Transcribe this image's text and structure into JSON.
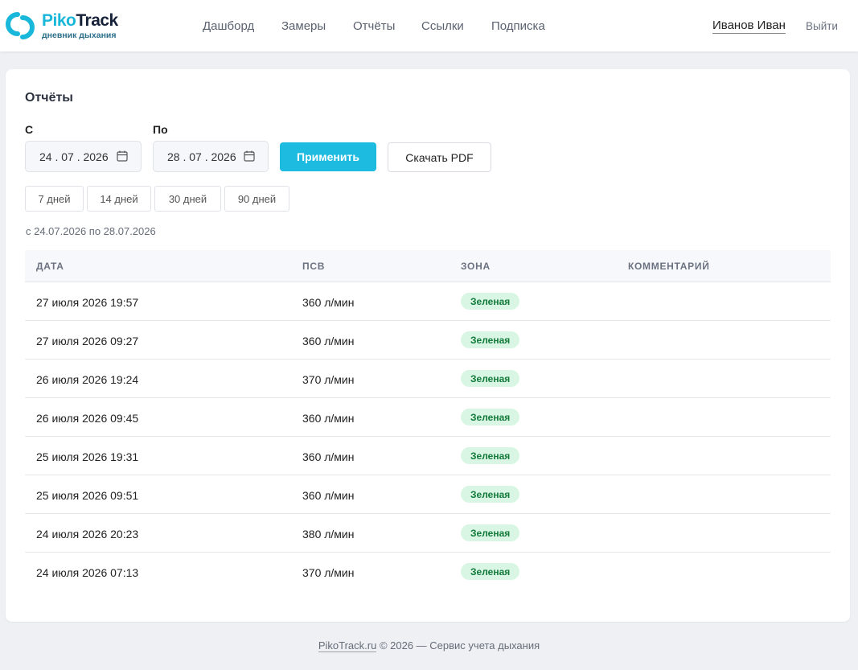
{
  "brand": {
    "name_part1": "Piko",
    "name_part2": "Track",
    "tagline": "дневник дыхания",
    "accent_color": "#1dbbe0"
  },
  "nav": {
    "items": [
      "Дашборд",
      "Замеры",
      "Отчёты",
      "Ссылки",
      "Подписка"
    ]
  },
  "user": {
    "name": "Иванов Иван",
    "logout": "Выйти"
  },
  "page": {
    "title": "Отчёты"
  },
  "filters": {
    "from_label": "С",
    "to_label": "По",
    "from_value": "24 . 07 . 2026",
    "to_value": "28 . 07 . 2026",
    "apply": "Применить",
    "download": "Скачать PDF",
    "ranges": [
      "7 дней",
      "14 дней",
      "30 дней",
      "90 дней"
    ],
    "range_text": "с 24.07.2026 по 28.07.2026"
  },
  "table": {
    "headers": [
      "ДАТА",
      "ПСВ",
      "ЗОНА",
      "КОММЕНТАРИЙ"
    ],
    "rows": [
      {
        "date": "27 июля 2026 19:57",
        "psv": "360 л/мин",
        "zone": "Зеленая",
        "comment": ""
      },
      {
        "date": "27 июля 2026 09:27",
        "psv": "360 л/мин",
        "zone": "Зеленая",
        "comment": ""
      },
      {
        "date": "26 июля 2026 19:24",
        "psv": "370 л/мин",
        "zone": "Зеленая",
        "comment": ""
      },
      {
        "date": "26 июля 2026 09:45",
        "psv": "360 л/мин",
        "zone": "Зеленая",
        "comment": ""
      },
      {
        "date": "25 июля 2026 19:31",
        "psv": "360 л/мин",
        "zone": "Зеленая",
        "comment": ""
      },
      {
        "date": "25 июля 2026 09:51",
        "psv": "360 л/мин",
        "zone": "Зеленая",
        "comment": ""
      },
      {
        "date": "24 июля 2026 20:23",
        "psv": "380 л/мин",
        "zone": "Зеленая",
        "comment": ""
      },
      {
        "date": "24 июля 2026 07:13",
        "psv": "370 л/мин",
        "zone": "Зеленая",
        "comment": ""
      }
    ]
  },
  "footer": {
    "link": "PikoTrack.ru",
    "text": " © 2026 — Сервис учета дыхания"
  }
}
